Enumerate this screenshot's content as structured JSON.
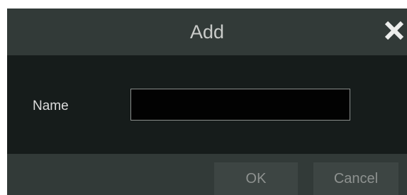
{
  "dialog": {
    "title": "Add",
    "close_icon": "close-icon",
    "name_label": "Name",
    "name_value": "",
    "name_placeholder": "",
    "ok_label": "OK",
    "cancel_label": "Cancel"
  },
  "colors": {
    "title_bar": "#323a38",
    "content_background": "#161c1b",
    "input_background": "#020202",
    "input_border": "#8a8e8c",
    "button_background": "#3d4543",
    "button_text": "#8e9290",
    "title_text": "#c9cbc9",
    "close_icon": "#ecedec"
  }
}
